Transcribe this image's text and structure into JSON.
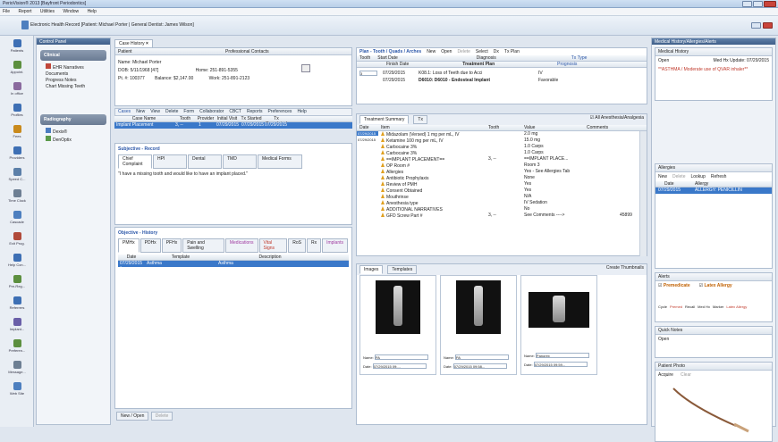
{
  "window": {
    "title": "PerioVision® 2013 [Bayfront Periodontics]"
  },
  "menu": [
    "File",
    "Report",
    "Utilities",
    "Window",
    "Help"
  ],
  "ribbon": {
    "title": "Electronic Health Record [Patient: Michael Porter | General Dentist: James Wilson]"
  },
  "sidebar": [
    {
      "label": "Patients",
      "icon": "patients-icon"
    },
    {
      "label": "Appoint.",
      "icon": "appointment-icon"
    },
    {
      "label": "In office",
      "icon": "in-office-icon"
    },
    {
      "label": "Profiles",
      "icon": "profiles-icon"
    },
    {
      "label": "Fees",
      "icon": "fees-icon"
    },
    {
      "label": "Providers",
      "icon": "providers-icon"
    },
    {
      "label": "Speed C...",
      "icon": "speed-icon"
    },
    {
      "label": "Time Clock",
      "icon": "time-clock-icon"
    },
    {
      "label": "Cascade",
      "icon": "cascade-icon"
    },
    {
      "label": "Exit Prog.",
      "icon": "exit-icon"
    },
    {
      "label": "Help Con...",
      "icon": "help-icon"
    },
    {
      "label": "Pre-Reg...",
      "icon": "pre-reg-icon"
    },
    {
      "label": "Referrers",
      "icon": "referrers-icon"
    },
    {
      "label": "Implant...",
      "icon": "implant-icon"
    },
    {
      "label": "Preferen...",
      "icon": "preferences-icon"
    },
    {
      "label": "Message...",
      "icon": "message-icon"
    },
    {
      "label": "Web Site",
      "icon": "web-icon"
    }
  ],
  "control_panel": {
    "title": "Control Panel",
    "clinical": {
      "label": "Clinical",
      "items": [
        "EHR Narratives",
        "Documents",
        "Progress Notes",
        "Chart Missing Teeth"
      ]
    },
    "radiography": {
      "label": "Radiography",
      "items": [
        "Dexis®",
        "DenOptix"
      ]
    }
  },
  "case_tab": {
    "label": "Case History"
  },
  "patient": {
    "header": "Patient",
    "contacts_header": "Professional Contacts",
    "name_label": "Name:",
    "name": "Michael Porter",
    "dob_label": "DOB:",
    "dob": "5/11/1968",
    "age": "[47]",
    "home_label": "Home:",
    "home": "251-891-5355",
    "pt_label": "Pt. #:",
    "pt_num": "100377",
    "balance_label": "Balance:",
    "balance": "$2,147.00",
    "work_label": "Work:",
    "work": "251-891-2123"
  },
  "cases_toolbar": [
    "Cases",
    "New",
    "View",
    "Delete",
    "Form",
    "Collaborator",
    "CBCT",
    "Reports",
    "Preferences",
    "Help"
  ],
  "case_cols": [
    "Case Name",
    "Tooth",
    "Provider",
    "Initial Visit",
    "Tx Started",
    "Tx Completed"
  ],
  "case_row": [
    "Implant Placement",
    "3, --",
    "1",
    "07/29/2015",
    "07/29/2015",
    "07/29/2015"
  ],
  "subjective": {
    "title": "Subjective - Record",
    "tabs": [
      "Chief Complaint",
      "HPI",
      "Dental",
      "TMD",
      "Medical Forms"
    ],
    "text": "\"I have a missing tooth and would like to have an implant placed.\""
  },
  "objective": {
    "title": "Objective - History",
    "tabs": [
      "PMHx",
      "PDHx",
      "PFHx",
      "Pain and Swelling",
      "Medications",
      "Vital Signs",
      "RoS",
      "Rx",
      "Implants"
    ],
    "cols": [
      "Date",
      "Template",
      "Description"
    ],
    "row": [
      "07/29/2015 (...",
      "Asthma",
      "Asthma"
    ]
  },
  "new_copy": [
    "New / Open",
    "Delete"
  ],
  "plan": {
    "title": "Plan - Tooth / Quads / Arches",
    "tools": [
      "New",
      "Open",
      "Delete",
      "Select",
      "Dx",
      "Tx Plan"
    ],
    "sub": [
      "Tooth",
      "Start Date",
      "Finish Date"
    ],
    "diag_label": "Diagnosis",
    "tx_label": "Treatment Plan",
    "txtype": "Tx Type",
    "prog": "Prognosis",
    "tooth": "3",
    "d1": "07/29/2015",
    "d2": "07/29/2015",
    "dx": "K08.1: Loss of Teeth due to Acci",
    "tx": "D6010: D6010 - Endosteal Implant",
    "iv": "IV",
    "fav": "Favorable"
  },
  "tx_summary": {
    "tabs": [
      "Treatment Summary",
      "Tx"
    ],
    "check": "All Anesthesia/Analgesia",
    "cols": [
      "Date",
      "Item",
      "Tooth",
      "Value",
      "Comments"
    ],
    "dates": [
      "07/29/2015",
      "07/29/2015"
    ],
    "rows": [
      [
        "Midazolam (Versed) 1 mg per mL, IV",
        "",
        "2.0 mg"
      ],
      [
        "Ketamine 100 mg per mL, IV",
        "",
        "15.0 mg"
      ],
      [
        "Carbocaine 3%",
        "",
        "1.0 Carps"
      ],
      [
        "Carbocaine 3%",
        "",
        "1.0 Carps"
      ],
      [
        "==IMPLANT PLACEMENT==",
        "3, --",
        "==IMPLANT PLACE..."
      ],
      [
        "OP Room #",
        "",
        "Room 3"
      ],
      [
        "Allergies",
        "",
        "Yes - See Allergies Tab"
      ],
      [
        "Antibiotic Prophylaxis",
        "",
        "None"
      ],
      [
        "Review of PMH",
        "",
        "Yes"
      ],
      [
        "Consent Obtained",
        "",
        "Yes"
      ],
      [
        "Mouthrinse",
        "",
        "N/A"
      ],
      [
        "Anesthesia type",
        "",
        "IV Sedation"
      ],
      [
        "ADDITIONAL NARRATIVES",
        "",
        "No"
      ],
      [
        "GFD Screw Part #",
        "3, --",
        "See Comments ---->"
      ]
    ],
    "comment": "45899"
  },
  "images": {
    "tabs": [
      "Images",
      "Templates"
    ],
    "create": "Create Thumbnails",
    "items": [
      {
        "name": "PA",
        "date": "07/29/2015 09:..."
      },
      {
        "name": "PA",
        "date": "07/29/2015 09:58..."
      },
      {
        "name": "Panorex",
        "date": "07/29/2015 09:59..."
      }
    ],
    "name_label": "Name:",
    "date_label": "Date:"
  },
  "medhist": {
    "title": "Medical History/Allergies/Alerts",
    "sec": "Medical History",
    "open": "Open",
    "update": "Med Hx Update: 07/29/2015",
    "note": "**ASTHMA / Moderate use of QVAR inhaler**"
  },
  "allergies": {
    "title": "Allergies",
    "tools": [
      "New",
      "Delete",
      "Lookup",
      "Refresh"
    ],
    "cols": [
      "Date",
      "Allergy"
    ],
    "row": [
      "07/29/2015",
      "ALLERGY: PENICILLIN"
    ]
  },
  "alerts": {
    "title": "Alerts",
    "items": [
      "Premedicate",
      "Latex Allergy"
    ],
    "legend": [
      "Cycle",
      "Premed",
      "Recall",
      "Med Hx",
      "Marker",
      "Latex Allergy"
    ]
  },
  "quick_notes": {
    "title": "Quick Notes",
    "open": "Open"
  },
  "patient_photo": {
    "title": "Patient Photo",
    "acquire": "Acquire",
    "clear": "Clear"
  }
}
